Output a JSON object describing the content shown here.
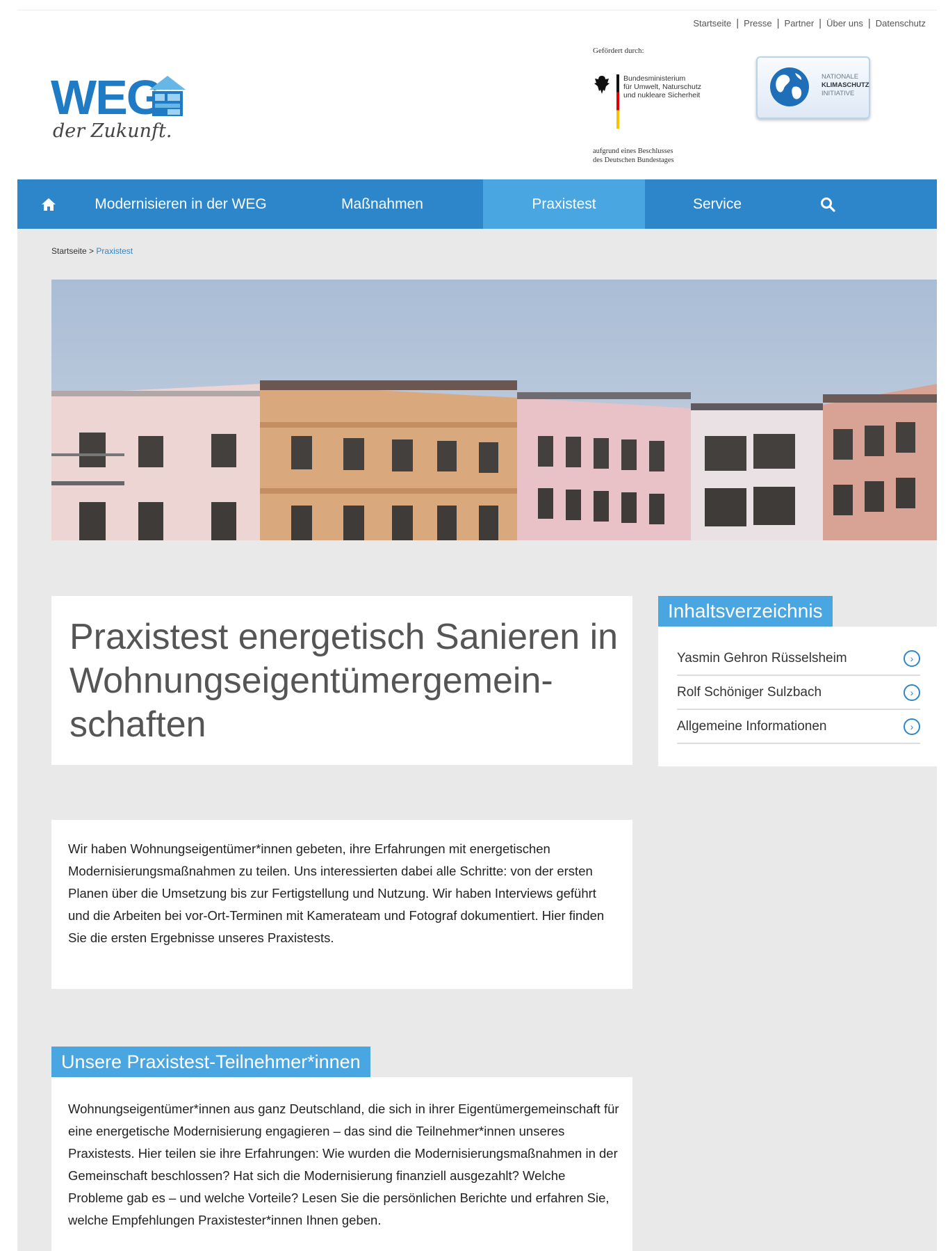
{
  "top_links": [
    "Startseite",
    "Presse",
    "Partner",
    "Über uns",
    "Datenschutz"
  ],
  "logo": {
    "word": "WEG",
    "tagline": "der Zukunft."
  },
  "funding": {
    "label": "Gefördert durch:",
    "ministry": [
      "Bundesministerium",
      "für Umwelt, Naturschutz",
      "und nukleare Sicherheit"
    ],
    "resolution": [
      "aufgrund eines Beschlusses",
      "des Deutschen Bundestages"
    ],
    "nki": [
      "NATIONALE",
      "KLIMASCHUTZ",
      "INITIATIVE"
    ]
  },
  "nav": {
    "home_icon": "home-icon",
    "items": [
      "Modernisieren in der WEG",
      "Maßnahmen",
      "Praxistest",
      "Service"
    ],
    "active": "Praxistest",
    "search_icon": "search-icon",
    "colors": {
      "bar": "#2c86c9",
      "active": "#4aa6e1"
    }
  },
  "breadcrumb": {
    "home": "Startseite",
    "separator": ">",
    "current": "Praxistest"
  },
  "title": "Praxistest energetisch Sanieren in Wohnungseigentümergemein-schaften",
  "toc": {
    "heading": "Inhaltsverzeichnis",
    "items": [
      "Yasmin Gehron Rüsselsheim",
      "Rolf Schöniger Sulzbach",
      "Allgemeine Informationen"
    ]
  },
  "intro": "Wir haben Wohnungseigentümer*innen gebeten, ihre Erfahrungen mit energetischen Modernisierungsmaßnahmen zu teilen. Uns interessierten dabei alle Schritte: von der ersten Planen über die Umsetzung bis zur Fertigstellung und Nutzung. Wir haben Interviews geführt und die Arbeiten bei vor-Ort-Terminen mit Kamerateam und Fotograf dokumentiert. Hier finden Sie die ersten Ergebnisse unseres Praxistests.",
  "participants": {
    "heading": "Unsere Praxistest-Teilnehmer*innen",
    "text": "Wohnungseigentümer*innen aus ganz Deutschland, die sich in ihrer Eigentümergemeinschaft für eine energetische Modernisierung engagieren – das sind die Teilnehmer*innen unseres Praxistests. Hier teilen sie ihre Erfahrungen: Wie wurden die Modernisierungsmaßnahmen in der Gemeinschaft beschlossen? Hat sich die Modernisierung finanziell ausgezahlt? Welche Probleme gab es – und welche Vorteile? Lesen Sie die persönlichen Berichte und erfahren Sie, welche Empfehlungen Praxistester*innen Ihnen geben."
  }
}
